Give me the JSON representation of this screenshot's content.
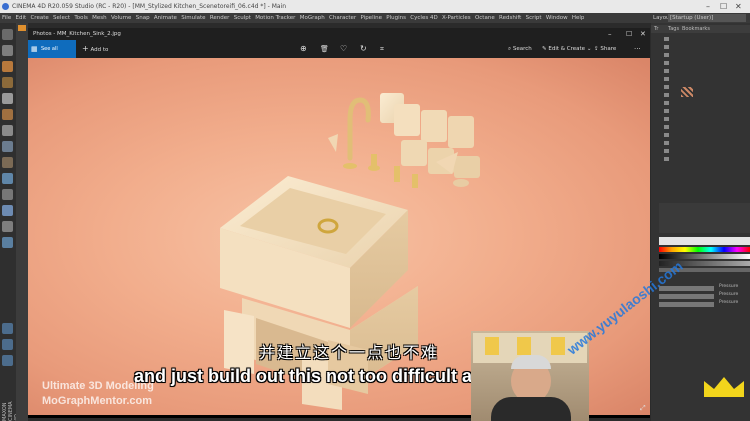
{
  "app": {
    "title": "CINEMA 4D R20.059 Studio (RC - R20) - [MM_Stylized Kitchen_Scenetoreifi_06.c4d *] - Main",
    "menu": [
      "File",
      "Edit",
      "Create",
      "Select",
      "Tools",
      "Mesh",
      "Volume",
      "Snap",
      "Animate",
      "Simulate",
      "Render",
      "Sculpt",
      "Motion Tracker",
      "MoGraph",
      "Character",
      "Pipeline",
      "Plugins",
      "Cycles 4D",
      "X-Particles",
      "Octane",
      "Redshift",
      "Script",
      "Window",
      "Help"
    ],
    "layout_label": "Layout:",
    "layout_value": "[Startup (User)]",
    "right_tabs": [
      "Tr",
      "Tags",
      "Bookmarks"
    ],
    "right_rows": [
      {
        "label": "Pressure"
      },
      {
        "label": "Pressure"
      },
      {
        "label": "Pressure"
      }
    ]
  },
  "photos": {
    "title": "Photos - MM_Kitchen_Sink_2.jpg",
    "see_all": "See all photos",
    "add_to": "Add to",
    "search": "Search",
    "edit_create": "Edit & Create",
    "share": "Share"
  },
  "video": {
    "subtitle_cn": "并建立这个一点也不难",
    "subtitle_en": "and just build out this not too difficult at all",
    "brand_line1": "Ultimate 3D Modeling",
    "brand_line2": "MoGraphMentor.com",
    "watermark": "www.yuyulaoshi.com",
    "left_vertical_label": "MAXON CINEMA 4D"
  },
  "colors": {
    "accent_blue": "#0f6cbd",
    "background_peach": "#f2ae8d",
    "sink_cream": "#f5e3c4",
    "gold": "#e4c06a",
    "crown_yellow": "#f2d51c"
  }
}
